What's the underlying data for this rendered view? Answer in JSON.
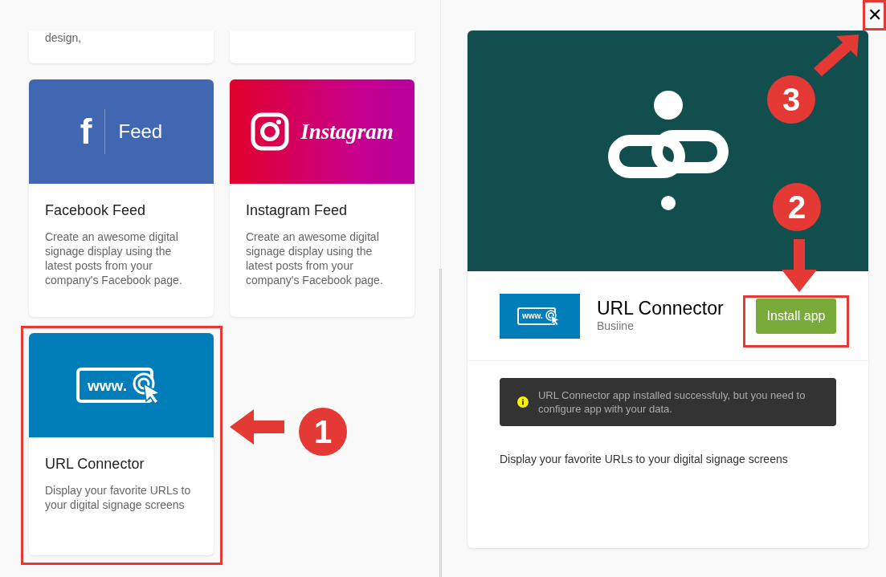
{
  "partial_cards": [
    {
      "kind": "text",
      "description": "design,"
    },
    {
      "kind": "blank"
    }
  ],
  "apps": [
    {
      "kind": "facebook",
      "banner_mark": "f",
      "banner_text": "Feed",
      "title": "Facebook Feed",
      "description": "Create an awesome digital signage display using the latest posts from your company's Facebook page."
    },
    {
      "kind": "instagram",
      "banner_text": "Instagram",
      "title": "Instagram Feed",
      "description": "Create an awesome digital signage display using the latest posts from your company's Facebook page."
    },
    {
      "kind": "url",
      "banner_text": "www.",
      "title": "URL Connector",
      "description": "Display your favorite URLs to your digital signage screens"
    }
  ],
  "detail": {
    "icon_text": "www.",
    "title": "URL Connector",
    "publisher": "Busiine",
    "install_button": "Install app",
    "alert": "URL Connector app installed successfuly, but you need to configure app with your data.",
    "description": "Display your favorite URLs to your digital signage screens"
  },
  "close_button": "✕",
  "annotations": [
    {
      "number": "1"
    },
    {
      "number": "2"
    },
    {
      "number": "3"
    }
  ]
}
